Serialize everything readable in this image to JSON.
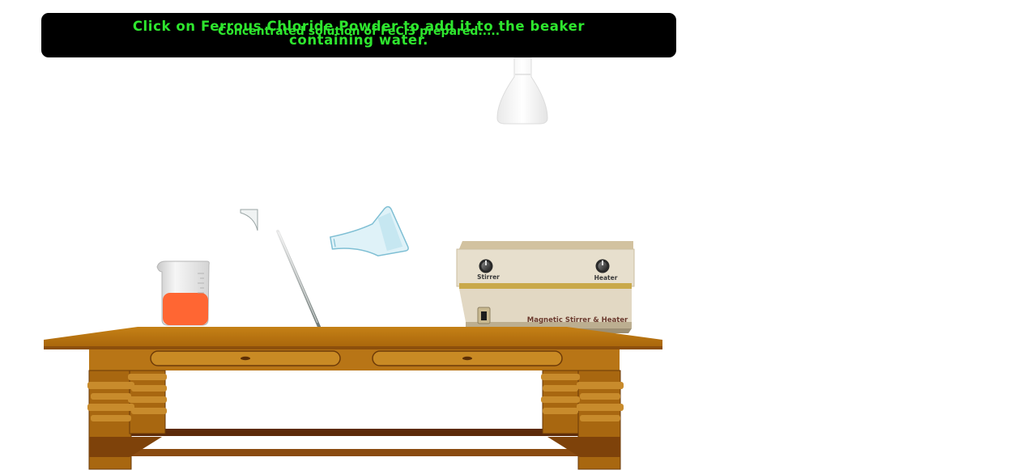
{
  "banner": {
    "instruction_line1": "Click on Ferrous Chloride Powder to add it to the beaker",
    "instruction_line2": "containing water.",
    "status": "Concentrated solution of FeCl3 prepared....."
  },
  "apparatus": {
    "stirrer_heater": {
      "stirrer_label": "Stirrer",
      "heater_label": "Heater",
      "name_label": "Magnetic Stirrer & Heater"
    }
  },
  "colors": {
    "banner_bg": "#000000",
    "banner_text": "#2ee62e",
    "beaker_solution": "#ff6633",
    "table_wood": "#b56f10",
    "device_body": "#e3d9c3"
  }
}
